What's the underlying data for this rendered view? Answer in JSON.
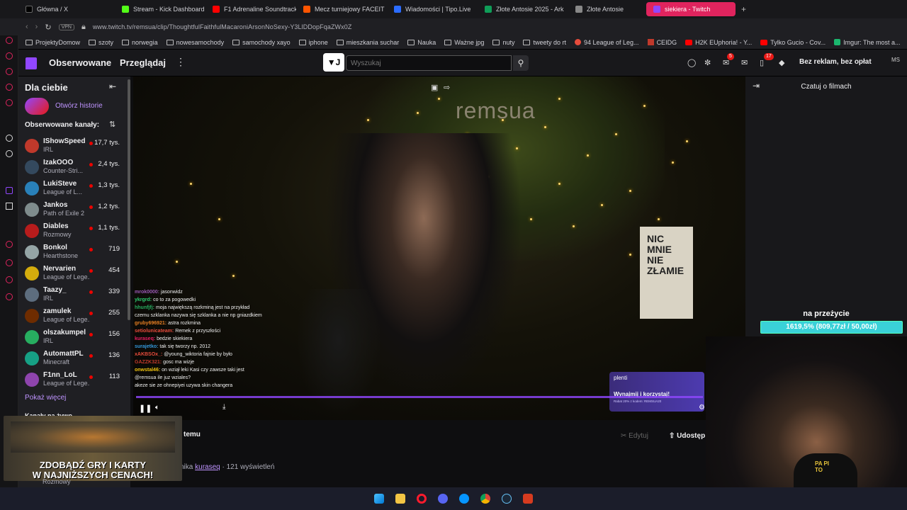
{
  "browser": {
    "tabs": [
      {
        "label": "Główna / X",
        "color": "#000000"
      },
      {
        "label": "Stream - Kick Dashboard",
        "color": "#53fc18"
      },
      {
        "label": "F1 Adrenaline Soundtrack",
        "color": "#ff0000"
      },
      {
        "label": "Mecz turniejowy FACEIT",
        "color": "#ff5500"
      },
      {
        "label": "Wiadomości | Tipo.Live",
        "color": "#2b6cff"
      },
      {
        "label": "Złote Antosie 2025 - Ark",
        "color": "#0f9d58"
      },
      {
        "label": "Złote Antosie",
        "color": "#888888"
      },
      {
        "label": "siekiera - Twitch",
        "color": "#9147ff"
      }
    ],
    "new_tab": "+",
    "vpn": "VPN",
    "url": "www.twitch.tv/remsua/clip/ThoughtfulFaithfulMacaroniArsonNoSexy-Y3LlDDopFqaZWx0Z",
    "bookmarks": [
      "ProjektyDomow",
      "szoty",
      "norwegia",
      "nowesamochody",
      "samochody xayo",
      "iphone",
      "mieszkania suchar",
      "Nauka",
      "Ważne jpg",
      "nuty",
      "tweety do rt",
      "94 League of Leg...",
      "CEIDG",
      "H2K EUphoria! - Y...",
      "Tylko Gucio - Cov...",
      "Imgur: The most a..."
    ]
  },
  "twitch_nav": {
    "following": "Obserwowane",
    "browse": "Przeglądaj",
    "search_placeholder": "Wyszukaj",
    "inbox_badge": "5",
    "notif_badge": "17",
    "ad_free": "Bez reklam, bez opłat",
    "user_initials": "MS"
  },
  "sidebar": {
    "title": "Dla ciebie",
    "story_label": "Otwórz historie",
    "followed_label": "Obserwowane kanały:",
    "channels": [
      {
        "name": "IShowSpeed",
        "game": "IRL",
        "viewers": "17,7 tys.",
        "color": "#c0392b"
      },
      {
        "name": "IzakOOO",
        "game": "Counter-Stri...",
        "viewers": "2,4 tys.",
        "color": "#34495e"
      },
      {
        "name": "LukiSteve",
        "game": "League of L...",
        "viewers": "1,3 tys.",
        "color": "#2980b9"
      },
      {
        "name": "Jankos",
        "game": "Path of Exile 2",
        "viewers": "1,2 tys.",
        "color": "#7f8c8d"
      },
      {
        "name": "Diables",
        "game": "Rozmowy",
        "viewers": "1,1 tys.",
        "color": "#b71c1c"
      },
      {
        "name": "Bonkol",
        "game": "Hearthstone",
        "viewers": "719",
        "color": "#95a5a6"
      },
      {
        "name": "Nervarien",
        "game": "League of Lege...",
        "viewers": "454",
        "color": "#d4ac0d"
      },
      {
        "name": "Taazy_",
        "game": "IRL",
        "viewers": "339",
        "color": "#5d6d7e"
      },
      {
        "name": "zamulek",
        "game": "League of Lege...",
        "viewers": "255",
        "color": "#6e2c00"
      },
      {
        "name": "olszakumpel",
        "game": "IRL",
        "viewers": "156",
        "color": "#27ae60"
      },
      {
        "name": "AutomattPL",
        "game": "Minecraft",
        "viewers": "136",
        "color": "#16a085"
      },
      {
        "name": "F1nn_LoL",
        "game": "League of Lege...",
        "viewers": "113",
        "color": "#8e44ad"
      }
    ],
    "show_more": "Pokaż więcej",
    "live_section": "Kanały na żywo",
    "last_game": "Rozmowy"
  },
  "video": {
    "watermark": "remsua",
    "poster_text": "NIC MNIE NIE ZŁAMIE",
    "overlay_chat": [
      {
        "user": "mrok0000:",
        "msg": "jasonwidz",
        "color": "#9b59b6"
      },
      {
        "user": "ykrgrd:",
        "msg": "co to za pogowedki",
        "color": "#2ecc71"
      },
      {
        "user": "hhunfjfj:",
        "msg": "moja największą rozkminą jest na przykład",
        "color": "#27ae60"
      },
      {
        "user": "",
        "msg": "czemu szklanka nazywa się szklanka a nie np gniazdkiem",
        "color": "#ffffff"
      },
      {
        "user": "gruby696921:",
        "msg": "astra rozkmina",
        "color": "#e67e22"
      },
      {
        "user": "setiolunicateam:",
        "msg": "Remek z przyszłości",
        "color": "#e74c3c"
      },
      {
        "user": "kuraseq:",
        "msg": "bedzie skiekiera",
        "color": "#e91e63"
      },
      {
        "user": "surajetko:",
        "msg": "tak się tworzy np. 2012",
        "color": "#3498db"
      },
      {
        "user": "xAKBSOx_:",
        "msg": "@young_wiktoria fajnie by było",
        "color": "#e74c3c"
      },
      {
        "user": "GAZZK321:",
        "msg": "gosc ma wizje",
        "color": "#c0392b"
      },
      {
        "user": "onwstal46:",
        "msg": "on wziął leki Kasi czy zawsze taki jest",
        "color": "#f1c40f"
      },
      {
        "user": "",
        "msg": "@remsua ile juz wziales?",
        "color": "#ffffff"
      },
      {
        "user": "",
        "msg": "akeze sie ze ohnepiyei uzywa skin changera",
        "color": "#ffffff"
      }
    ],
    "ad": {
      "brand": "plenti",
      "text": "Wynajmij i korzystaj!",
      "sub": "Rabat 20% z kodem: REMSUA20"
    }
  },
  "below_video": {
    "time_ago": "temu",
    "edit": "Edytuj",
    "share": "Udostęp",
    "meta_prefix": "nika",
    "meta_user": "kuraseq",
    "meta_views": "· 121 wyświetleń"
  },
  "right_panel": {
    "title": "Czatuj o filmach",
    "goal_label": "na przeżycie",
    "goal_text": "1619,5% (809,77zł / 50,00zł)",
    "goal_progress_percent": 100
  },
  "webcam": {
    "shirt_text": "PA PI TO"
  },
  "popup_ad": {
    "line1": "ZDOBĄDŹ GRY I KARTY",
    "line2": "W NAJNIŻSZYCH CENACH!"
  },
  "taskbar": {
    "icons": [
      "windows-icon",
      "folder-icon",
      "opera-icon",
      "discord-icon",
      "messenger-icon",
      "chrome-icon",
      "steam-icon",
      "game-icon"
    ]
  }
}
